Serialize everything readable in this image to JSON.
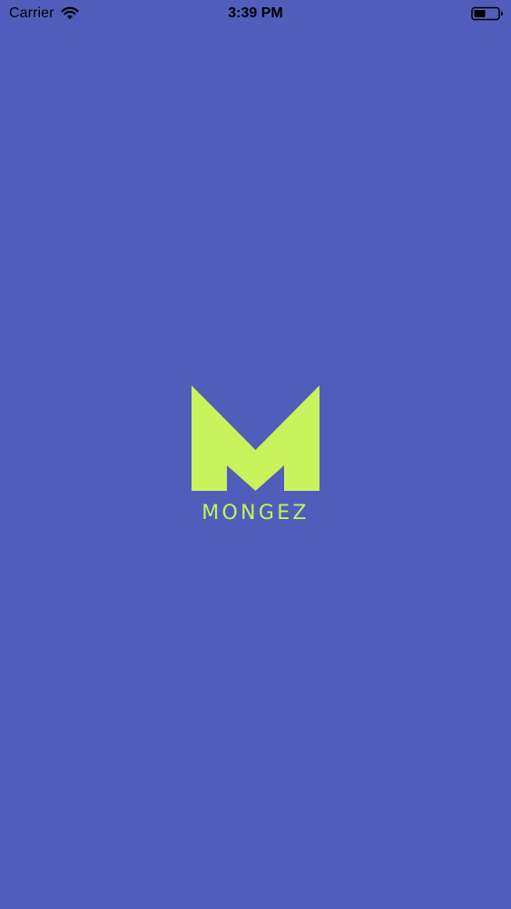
{
  "status_bar": {
    "carrier": "Carrier",
    "time": "3:39 PM",
    "icons": [
      "wifi-icon",
      "battery-icon"
    ]
  },
  "splash": {
    "brand_name": "MONGEZ",
    "logo_icon": "mongez-logo-icon",
    "colors": {
      "background": "#505dbb",
      "logo": "#c9f25c"
    }
  }
}
